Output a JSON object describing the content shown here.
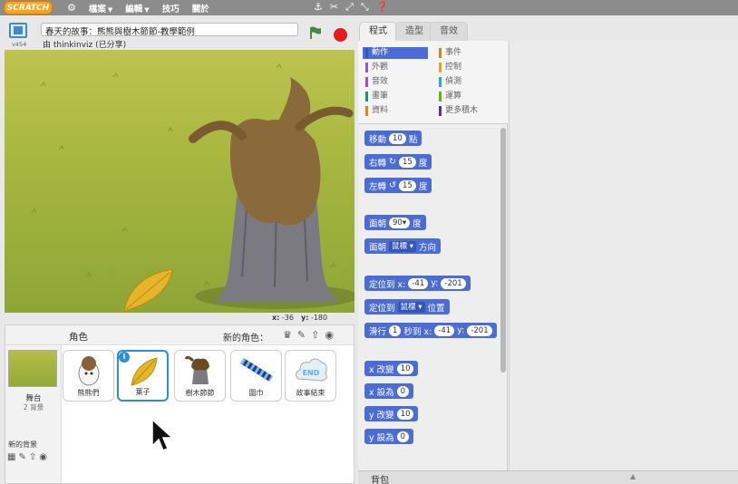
{
  "menubar": {
    "logo_text": "SCRATCH",
    "file_label": "檔案",
    "edit_label": "編輯",
    "tips_label": "技巧",
    "about_label": "關於"
  },
  "stage": {
    "version": "v454",
    "project_title": "春天的故事：熊熊與樹木節節-教學範例",
    "author": "由 thinkinviz (已分享)",
    "x_label": "x:",
    "x_value": "-36",
    "y_label": "y:",
    "y_value": "-180"
  },
  "sprites": {
    "header_label": "角色",
    "new_sprite_label": "新的角色：",
    "stage_label": "舞台",
    "stage_count": "2 背景",
    "new_backdrop_label": "新的背景",
    "items": [
      {
        "label": "熊熊們"
      },
      {
        "label": "葉子"
      },
      {
        "label": "樹木節節"
      },
      {
        "label": "圍巾"
      },
      {
        "label": "故事結束",
        "thumb_text": "END"
      }
    ]
  },
  "tabs": {
    "scripts": "程式",
    "costumes": "造型",
    "sounds": "音效"
  },
  "categories": [
    {
      "label": "動作",
      "color": "#4a6cd4"
    },
    {
      "label": "外觀",
      "color": "#8a55d7"
    },
    {
      "label": "音效",
      "color": "#bb42c3"
    },
    {
      "label": "畫筆",
      "color": "#0e9a6c"
    },
    {
      "label": "資料",
      "color": "#ee7d16"
    },
    {
      "label": "事件",
      "color": "#c88330"
    },
    {
      "label": "控制",
      "color": "#e1a91a"
    },
    {
      "label": "偵測",
      "color": "#2ca5e2"
    },
    {
      "label": "運算",
      "color": "#5cb712"
    },
    {
      "label": "更多積木",
      "color": "#632d99"
    }
  ],
  "blocks": {
    "move_a": "移動",
    "move_val": "10",
    "move_b": "點",
    "turn_right_a": "右轉",
    "turn_right_val": "15",
    "turn_right_b": "度",
    "turn_left_a": "左轉",
    "turn_left_val": "15",
    "turn_left_b": "度",
    "point_dir_a": "面朝",
    "point_dir_val": "90▾",
    "point_dir_b": "度",
    "point_toward_a": "面朝",
    "point_toward_val": "鼠標",
    "point_toward_b": "方向",
    "goto_xy_a": "定位到 x:",
    "goto_xy_x": "-41",
    "goto_xy_b": "y:",
    "goto_xy_y": "-201",
    "goto_a": "定位到",
    "goto_val": "鼠標",
    "goto_b": "位置",
    "glide_a": "滑行",
    "glide_secs": "1",
    "glide_b": "秒到 x:",
    "glide_x": "-41",
    "glide_c": "y:",
    "glide_y": "-201",
    "change_x_a": "x 改變",
    "change_x_val": "10",
    "set_x_a": "x 設為",
    "set_x_val": "0",
    "change_y_a": "y 改變",
    "change_y_val": "10",
    "set_y_a": "y 設為",
    "set_y_val": "0"
  },
  "backpack": {
    "label": "背包"
  }
}
